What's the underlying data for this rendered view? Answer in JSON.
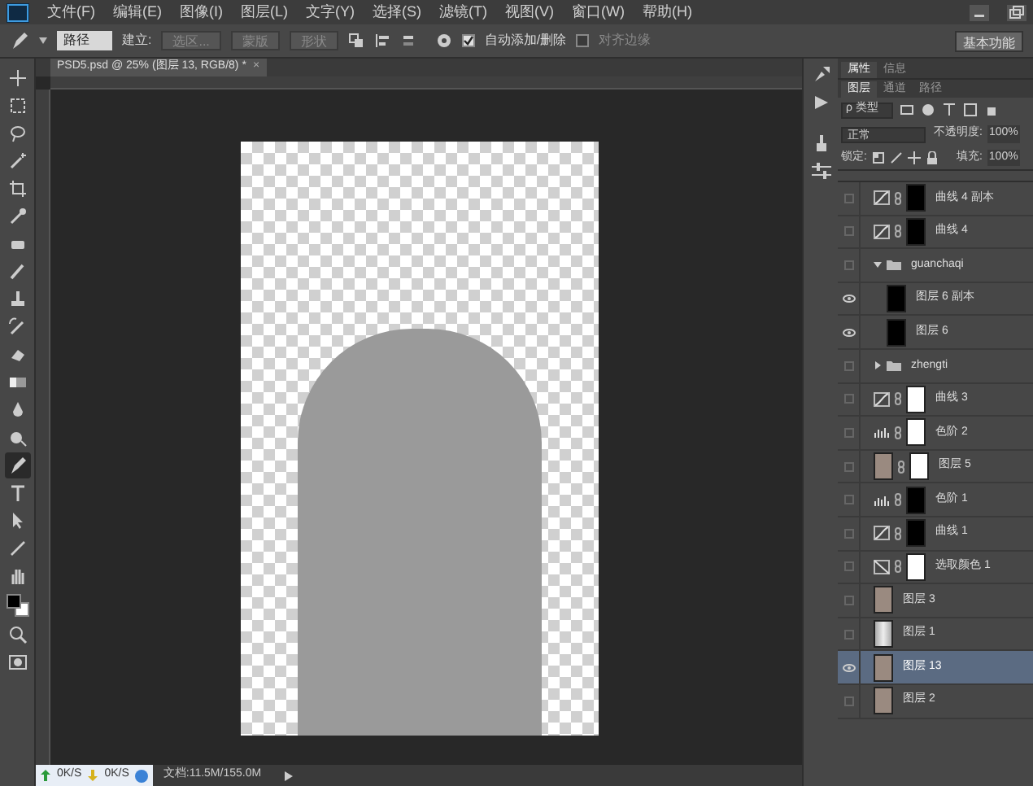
{
  "menu": [
    "文件(F)",
    "编辑(E)",
    "图像(I)",
    "图层(L)",
    "文字(Y)",
    "选择(S)",
    "滤镜(T)",
    "视图(V)",
    "窗口(W)",
    "帮助(H)"
  ],
  "options_bar": {
    "mode": "路径",
    "make_label": "建立:",
    "make_buttons": [
      "选区...",
      "蒙版",
      "形状"
    ],
    "checkboxes": [
      {
        "label": "自动添加/删除",
        "checked": true
      },
      {
        "label": "对齐边缘",
        "checked": false
      }
    ],
    "workspace": "基本功能"
  },
  "document_tab": {
    "title": "PSD5.psd @ 25% (图层 13, RGB/8) *",
    "close": "×"
  },
  "tools": [
    {
      "selected": false
    },
    {
      "selected": false
    },
    {
      "selected": false
    },
    {
      "selected": false
    },
    {
      "selected": false
    },
    {
      "selected": false
    },
    {
      "selected": false
    },
    {
      "selected": false
    },
    {
      "selected": false
    },
    {
      "selected": false
    },
    {
      "selected": false
    },
    {
      "selected": false
    },
    {
      "selected": false
    },
    {
      "selected": false
    },
    {
      "selected": true
    },
    {
      "selected": false
    },
    {
      "selected": false
    },
    {
      "selected": false
    },
    {
      "selected": false
    },
    {
      "selected": false
    },
    {
      "selected": false
    }
  ],
  "status_bar": {
    "upload": "0K/S",
    "download": "0K/S",
    "document": "文档:11.5M/155.0M"
  },
  "panel_tabs_top": [
    {
      "label": "属性",
      "selected": true
    },
    {
      "label": "信息",
      "selected": false
    }
  ],
  "panel_tabs": [
    {
      "label": "图层",
      "selected": true
    },
    {
      "label": "通道",
      "selected": false
    },
    {
      "label": "路径",
      "selected": false
    }
  ],
  "filter": {
    "icon": "ρ",
    "value": "类型"
  },
  "blend_mode": "正常",
  "opacity_label": "不透明度:",
  "opacity": "100%",
  "lock_label": "锁定:",
  "fill_label": "填充:",
  "fill": "100%",
  "layers": [
    {
      "name": "曲线 4 副本",
      "kind": "curves",
      "visible": false,
      "selected": false,
      "mask": {
        "kind": "dark"
      }
    },
    {
      "name": "曲线 4",
      "kind": "curves",
      "visible": false,
      "selected": false,
      "mask": {
        "kind": "dark"
      }
    },
    {
      "name": "guanchaqi",
      "kind": "group",
      "visible": false,
      "selected": false,
      "expanded": true,
      "children": [
        {
          "name": "图层 6 副本",
          "kind": "pixel",
          "visible": true,
          "selected": false,
          "thumb": {
            "kind": "dark"
          }
        },
        {
          "name": "图层 6",
          "kind": "pixel",
          "visible": true,
          "selected": false,
          "thumb": {
            "kind": "dark"
          }
        }
      ]
    },
    {
      "name": "zhengti",
      "kind": "group",
      "visible": false,
      "selected": false,
      "expanded": false
    },
    {
      "name": "曲线 3",
      "kind": "curves",
      "visible": false,
      "selected": false,
      "mask": {
        "kind": "light"
      }
    },
    {
      "name": "色阶 2",
      "kind": "levels",
      "visible": false,
      "selected": false,
      "mask": {
        "kind": "light"
      }
    },
    {
      "name": "图层 5",
      "kind": "pixel_mask",
      "visible": false,
      "selected": false,
      "thumb": {
        "kind": "photo"
      },
      "mask": {
        "kind": "light"
      }
    },
    {
      "name": "色阶 1",
      "kind": "levels",
      "visible": false,
      "selected": false,
      "mask": {
        "kind": "dark"
      }
    },
    {
      "name": "曲线 1",
      "kind": "curves",
      "visible": false,
      "selected": false,
      "mask": {
        "kind": "dark"
      }
    },
    {
      "name": "选取颜色 1",
      "kind": "selective_color",
      "visible": false,
      "selected": false,
      "mask": {
        "kind": "light"
      }
    },
    {
      "name": "图层 3",
      "kind": "pixel",
      "visible": false,
      "selected": false,
      "thumb": {
        "kind": "photo"
      }
    },
    {
      "name": "图层 1",
      "kind": "pixel",
      "visible": false,
      "selected": false,
      "thumb": {
        "kind": "gradient"
      }
    },
    {
      "name": "图层 13",
      "kind": "pixel",
      "visible": true,
      "selected": true,
      "thumb": {
        "kind": "photo"
      }
    },
    {
      "name": "图层 2",
      "kind": "pixel",
      "visible": false,
      "selected": false,
      "thumb": {
        "kind": "photo"
      }
    }
  ]
}
